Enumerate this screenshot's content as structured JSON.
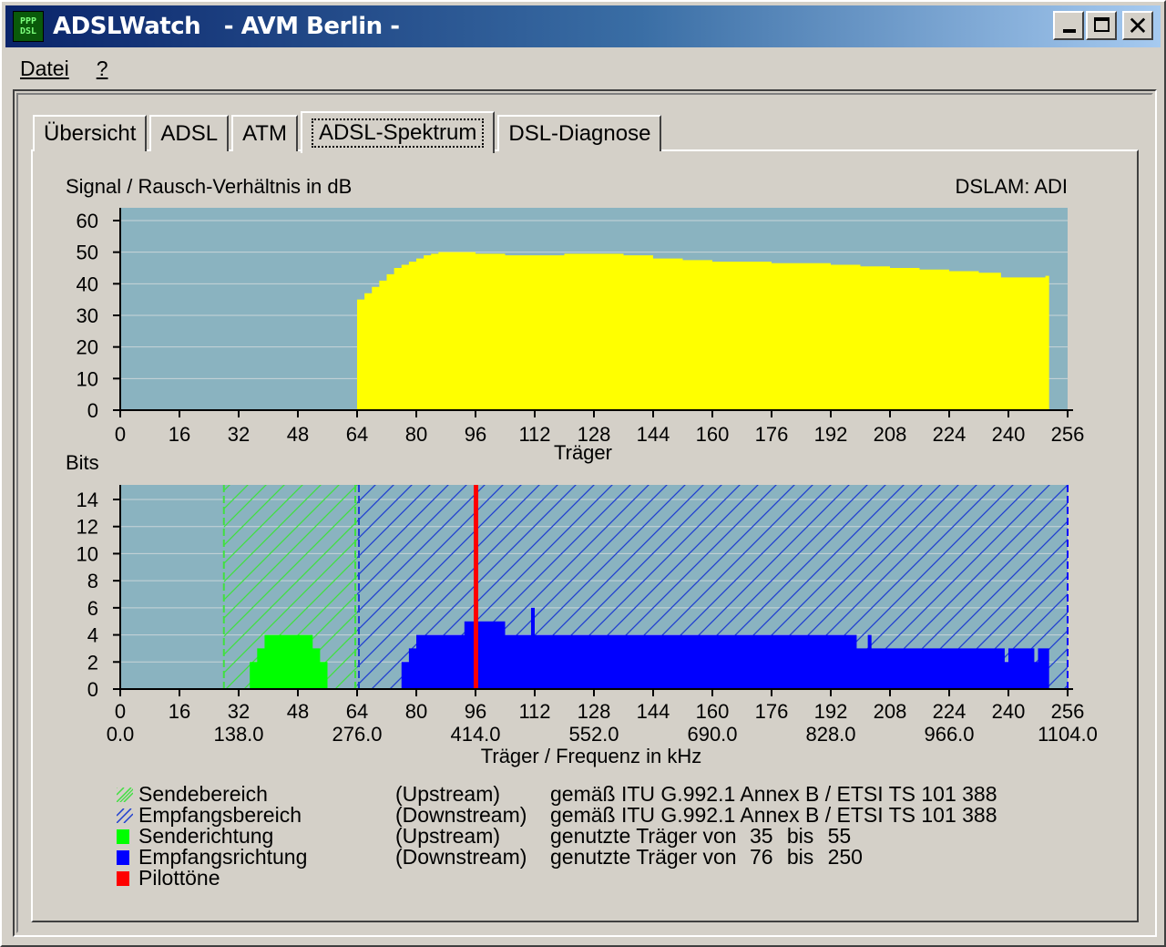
{
  "window": {
    "icon_text_top": "PPP",
    "icon_text_bottom": "DSL",
    "title": "ADSLWatch   - AVM Berlin -",
    "close_glyph": "✕"
  },
  "menu": [
    {
      "label": "Datei"
    },
    {
      "label": "?"
    }
  ],
  "tabs": [
    {
      "label": "Übersicht",
      "active": false
    },
    {
      "label": "ADSL",
      "active": false
    },
    {
      "label": "ATM",
      "active": false
    },
    {
      "label": "ADSL-Spektrum",
      "active": true
    },
    {
      "label": "DSL-Diagnose",
      "active": false
    }
  ],
  "colors": {
    "plot_bg": "#8ab3c0",
    "snr": "#ffff00",
    "upstream": "#00ff00",
    "downstream": "#0000ff",
    "pilot": "#ff0000",
    "upstream_hatch": "#40e040",
    "downstream_hatch": "#1f3fd0"
  },
  "chart_data": [
    {
      "type": "area",
      "title": "Signal / Rausch-Verhältnis in dB",
      "annotation": "DSLAM: ADI",
      "xlabel": "Träger",
      "xlim": [
        0,
        256
      ],
      "ylim": [
        0,
        60
      ],
      "x_ticks": [
        "0",
        "16",
        "32",
        "48",
        "64",
        "80",
        "96",
        "112",
        "128",
        "144",
        "160",
        "176",
        "192",
        "208",
        "224",
        "240",
        "256"
      ],
      "y_ticks": [
        "60",
        "50",
        "40",
        "30",
        "20",
        "10",
        "0"
      ],
      "grid": true,
      "series": [
        {
          "points": [
            [
              64,
              35
            ],
            [
              66,
              37
            ],
            [
              68,
              39
            ],
            [
              70,
              41
            ],
            [
              72,
              43
            ],
            [
              74,
              45
            ],
            [
              76,
              46
            ],
            [
              78,
              47
            ],
            [
              80,
              48
            ],
            [
              82,
              49
            ],
            [
              84,
              49.5
            ],
            [
              86,
              50
            ],
            [
              88,
              50
            ],
            [
              92,
              50
            ],
            [
              96,
              49.5
            ],
            [
              104,
              49
            ],
            [
              112,
              49
            ],
            [
              120,
              49.5
            ],
            [
              128,
              49.5
            ],
            [
              136,
              49
            ],
            [
              144,
              48
            ],
            [
              152,
              47.5
            ],
            [
              160,
              47
            ],
            [
              168,
              47
            ],
            [
              176,
              46.5
            ],
            [
              184,
              46.5
            ],
            [
              192,
              46
            ],
            [
              200,
              45.5
            ],
            [
              208,
              45
            ],
            [
              216,
              44.5
            ],
            [
              224,
              44
            ],
            [
              232,
              43.5
            ],
            [
              238,
              42
            ],
            [
              244,
              42
            ],
            [
              250,
              42.5
            ],
            [
              251,
              0
            ]
          ]
        }
      ]
    },
    {
      "type": "bar",
      "title": "Bits",
      "xlabel": "Träger / Frequenz in kHz",
      "xlim": [
        0,
        256
      ],
      "ylim": [
        0,
        15
      ],
      "x_ticks": [
        "0",
        "16",
        "32",
        "48",
        "64",
        "80",
        "96",
        "112",
        "128",
        "144",
        "160",
        "176",
        "192",
        "208",
        "224",
        "240",
        "256"
      ],
      "freq_ticks": [
        {
          "carrier": 0,
          "label": "0.0"
        },
        {
          "carrier": 32,
          "label": "138.0"
        },
        {
          "carrier": 64,
          "label": "276.0"
        },
        {
          "carrier": 96,
          "label": "414.0"
        },
        {
          "carrier": 128,
          "label": "552.0"
        },
        {
          "carrier": 160,
          "label": "690.0"
        },
        {
          "carrier": 192,
          "label": "828.0"
        },
        {
          "carrier": 224,
          "label": "966.0"
        },
        {
          "carrier": 256,
          "label": "1104.0"
        }
      ],
      "y_ticks": [
        "14",
        "12",
        "10",
        "8",
        "6",
        "4",
        "2",
        "0"
      ],
      "grid": true,
      "upstream_range": [
        28,
        64
      ],
      "downstream_range": [
        64,
        256
      ],
      "pilot_carrier": 96,
      "upstream_bits": [
        [
          35,
          2
        ],
        [
          37,
          3
        ],
        [
          39,
          4
        ],
        [
          52,
          3
        ],
        [
          54,
          2
        ],
        [
          56,
          0
        ]
      ],
      "downstream_bits": [
        [
          76,
          2
        ],
        [
          78,
          3
        ],
        [
          80,
          4
        ],
        [
          93,
          5
        ],
        [
          104,
          4
        ],
        [
          110,
          4
        ],
        [
          111,
          6
        ],
        [
          112,
          4
        ],
        [
          199,
          3
        ],
        [
          202,
          4
        ],
        [
          203,
          3
        ],
        [
          239,
          2
        ],
        [
          240,
          3
        ],
        [
          247,
          2
        ],
        [
          248,
          3
        ],
        [
          251,
          0
        ]
      ]
    }
  ],
  "legend": [
    {
      "symbol": "hatch-green",
      "name": "Sendebereich",
      "direction": "(Upstream)",
      "description": "gemäß ITU G.992.1 Annex B / ETSI TS 101 388"
    },
    {
      "symbol": "hatch-blue",
      "name": "Empfangsbereich",
      "direction": "(Downstream)",
      "description": "gemäß ITU G.992.1 Annex B / ETSI TS 101 388"
    },
    {
      "symbol": "solid-green",
      "name": "Senderichtung",
      "direction": "(Upstream)",
      "description": "genutzte Träger von",
      "from": "35",
      "bis": "bis",
      "to": "55"
    },
    {
      "symbol": "solid-blue",
      "name": "Empfangsrichtung",
      "direction": "(Downstream)",
      "description": "genutzte Träger von",
      "from": "76",
      "bis": "bis",
      "to": "250"
    },
    {
      "symbol": "solid-red",
      "name": "Pilottöne"
    }
  ]
}
